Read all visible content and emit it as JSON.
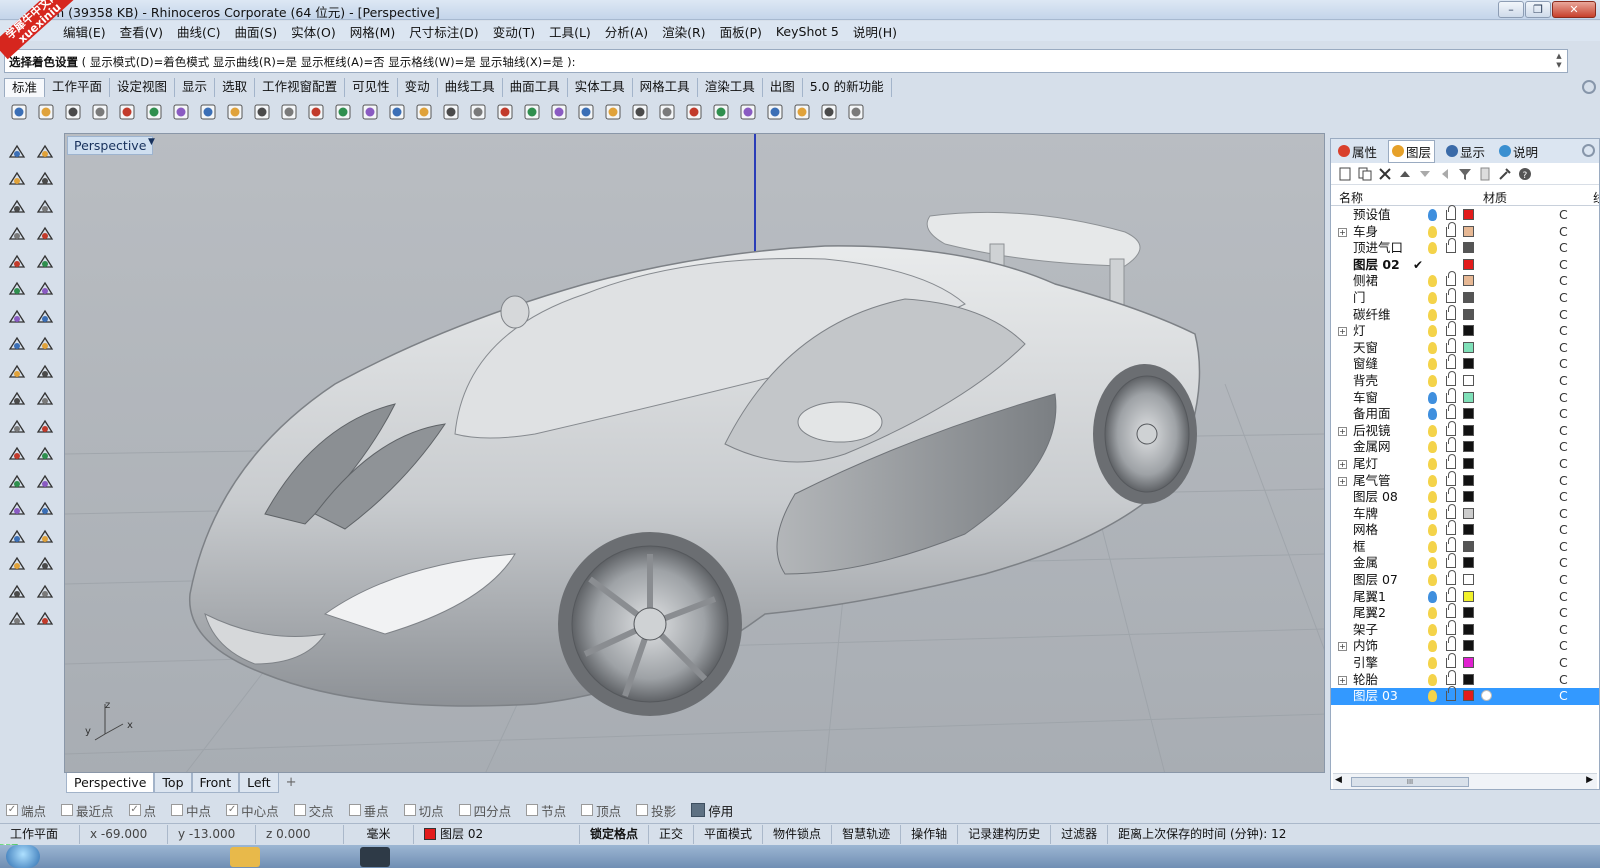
{
  "window": {
    "title": "m (39358 KB) - Rhinoceros Corporate (64 位元) - [Perspective]",
    "watermark": "学犀牛中文网 xuexiniu"
  },
  "menu": [
    "编辑(E)",
    "查看(V)",
    "曲线(C)",
    "曲面(S)",
    "实体(O)",
    "网格(M)",
    "尺寸标注(D)",
    "变动(T)",
    "工具(L)",
    "分析(A)",
    "渲染(R)",
    "面板(P)",
    "KeyShot 5",
    "说明(H)"
  ],
  "command": {
    "label": "选择着色设置",
    "options": "( 显示模式(D)=着色模式  显示曲线(R)=是  显示框线(A)=否  显示格线(W)=是  显示轴线(X)=是 ):"
  },
  "toolbar_tabs": [
    "标准",
    "工作平面",
    "设定视图",
    "显示",
    "选取",
    "工作视窗配置",
    "可见性",
    "变动",
    "曲线工具",
    "曲面工具",
    "实体工具",
    "网格工具",
    "渲染工具",
    "出图",
    "5.0 的新功能"
  ],
  "toolbar_icons": [
    "new-file-icon",
    "open-folder-icon",
    "save-icon",
    "print-icon",
    "export-icon",
    "cut-icon",
    "copy-icon",
    "paste-icon",
    "undo-icon",
    "pan-hand-icon",
    "move-view-icon",
    "zoom-icon",
    "zoom-window-icon",
    "zoom-extents-icon",
    "zoom-selected-icon",
    "rotate-view-icon",
    "four-viewports-icon",
    "car-icon",
    "car-ghost-icon",
    "clock-icon",
    "snap-icon",
    "light-bulb-icon",
    "lock-icon",
    "layer-icon",
    "color-wheel-icon",
    "render-sphere-icon",
    "shaded-sphere-icon",
    "material-sphere-icon",
    "render-icon",
    "gear-icon",
    "grid-icon",
    "help-icon"
  ],
  "viewport": {
    "label": "Perspective",
    "axis": {
      "x": "x",
      "y": "y",
      "z": "z"
    }
  },
  "viewport_tabs": [
    "Perspective",
    "Top",
    "Front",
    "Left",
    "+"
  ],
  "panel": {
    "tabs": [
      {
        "label": "属性",
        "color": "#d9402c"
      },
      {
        "label": "图层",
        "color": "#e6a12a"
      },
      {
        "label": "显示",
        "color": "#3a6aa8"
      },
      {
        "label": "说明",
        "color": "#3a8fd0"
      }
    ],
    "columns": {
      "name": "名称",
      "material": "材质",
      "extra": "线"
    },
    "layers": [
      {
        "name": "预设值",
        "expand": false,
        "bulb": "#3f8fde",
        "color": "#e31b1b",
        "current": false
      },
      {
        "name": "车身",
        "expand": true,
        "bulb": "#f4d34a",
        "color": "#e7b894",
        "current": false
      },
      {
        "name": "顶进气口",
        "expand": false,
        "bulb": "#f4d34a",
        "color": "#555555",
        "current": false
      },
      {
        "name": "图层 02",
        "expand": false,
        "bulb": "",
        "color": "#e31b1b",
        "current": true
      },
      {
        "name": "侧裙",
        "expand": false,
        "bulb": "#f4d34a",
        "color": "#e7b894",
        "current": false
      },
      {
        "name": "门",
        "expand": false,
        "bulb": "#f4d34a",
        "color": "#555555",
        "current": false
      },
      {
        "name": "碳纤维",
        "expand": false,
        "bulb": "#f4d34a",
        "color": "#555555",
        "current": false
      },
      {
        "name": "灯",
        "expand": true,
        "bulb": "#f4d34a",
        "color": "#111111",
        "current": false
      },
      {
        "name": "天窗",
        "expand": false,
        "bulb": "#f4d34a",
        "color": "#7fe0b8",
        "current": false
      },
      {
        "name": "窗缝",
        "expand": false,
        "bulb": "#f4d34a",
        "color": "#111111",
        "current": false
      },
      {
        "name": "背壳",
        "expand": false,
        "bulb": "#f4d34a",
        "color": "#ffffff",
        "current": false
      },
      {
        "name": "车窗",
        "expand": false,
        "bulb": "#3f8fde",
        "color": "#7fe0b8",
        "current": false
      },
      {
        "name": "备用面",
        "expand": false,
        "bulb": "#3f8fde",
        "color": "#111111",
        "current": false
      },
      {
        "name": "后视镜",
        "expand": true,
        "bulb": "#f4d34a",
        "color": "#111111",
        "current": false
      },
      {
        "name": "金属网",
        "expand": false,
        "bulb": "#f4d34a",
        "color": "#111111",
        "current": false
      },
      {
        "name": "尾灯",
        "expand": true,
        "bulb": "#f4d34a",
        "color": "#111111",
        "current": false
      },
      {
        "name": "尾气管",
        "expand": true,
        "bulb": "#f4d34a",
        "color": "#111111",
        "current": false
      },
      {
        "name": "图层 08",
        "expand": false,
        "bulb": "#f4d34a",
        "color": "#111111",
        "current": false
      },
      {
        "name": "车牌",
        "expand": false,
        "bulb": "#f4d34a",
        "color": "#cccccc",
        "current": false
      },
      {
        "name": "网格",
        "expand": false,
        "bulb": "#f4d34a",
        "color": "#111111",
        "current": false
      },
      {
        "name": "框",
        "expand": false,
        "bulb": "#f4d34a",
        "color": "#555555",
        "current": false
      },
      {
        "name": "金属",
        "expand": false,
        "bulb": "#f4d34a",
        "color": "#111111",
        "current": false
      },
      {
        "name": "图层 07",
        "expand": false,
        "bulb": "#f4d34a",
        "color": "#ffffff",
        "current": false
      },
      {
        "name": "尾翼1",
        "expand": false,
        "bulb": "#3f8fde",
        "color": "#f1f12a",
        "current": false
      },
      {
        "name": "尾翼2",
        "expand": false,
        "bulb": "#f4d34a",
        "color": "#111111",
        "current": false
      },
      {
        "name": "架子",
        "expand": false,
        "bulb": "#f4d34a",
        "color": "#111111",
        "current": false
      },
      {
        "name": "内饰",
        "expand": true,
        "bulb": "#f4d34a",
        "color": "#111111",
        "current": false
      },
      {
        "name": "引擎",
        "expand": false,
        "bulb": "#f4d34a",
        "color": "#e020d0",
        "current": false
      },
      {
        "name": "轮胎",
        "expand": true,
        "bulb": "#f4d34a",
        "color": "#111111",
        "current": false
      },
      {
        "name": "图层 03",
        "expand": false,
        "bulb": "#f4d34a",
        "color": "#e31b1b",
        "current": false,
        "selected": true
      }
    ],
    "extra_text": "C",
    "current_mark": "✔",
    "scroll_grip": "III"
  },
  "osnaps": [
    {
      "label": "端点",
      "checked": true
    },
    {
      "label": "最近点",
      "checked": false
    },
    {
      "label": "点",
      "checked": true
    },
    {
      "label": "中点",
      "checked": false
    },
    {
      "label": "中心点",
      "checked": true
    },
    {
      "label": "交点",
      "checked": false
    },
    {
      "label": "垂点",
      "checked": false
    },
    {
      "label": "切点",
      "checked": false
    },
    {
      "label": "四分点",
      "checked": false
    },
    {
      "label": "节点",
      "checked": false
    },
    {
      "label": "顶点",
      "checked": false
    },
    {
      "label": "投影",
      "checked": false
    },
    {
      "label": "停用",
      "checked": false,
      "disable": true
    }
  ],
  "status": {
    "cplane": "工作平面",
    "x": "x -69.000",
    "y": "y -13.000",
    "z": "z 0.000",
    "unit": "毫米",
    "layer": "图层 02",
    "layer_color": "#e31b1b",
    "toggles": [
      "锁定格点",
      "正交",
      "平面模式",
      "物件锁点",
      "智慧轨迹",
      "操作轴",
      "记录建构历史",
      "过滤器"
    ],
    "autosave": "距离上次保存的时间 (分钟): 12"
  }
}
